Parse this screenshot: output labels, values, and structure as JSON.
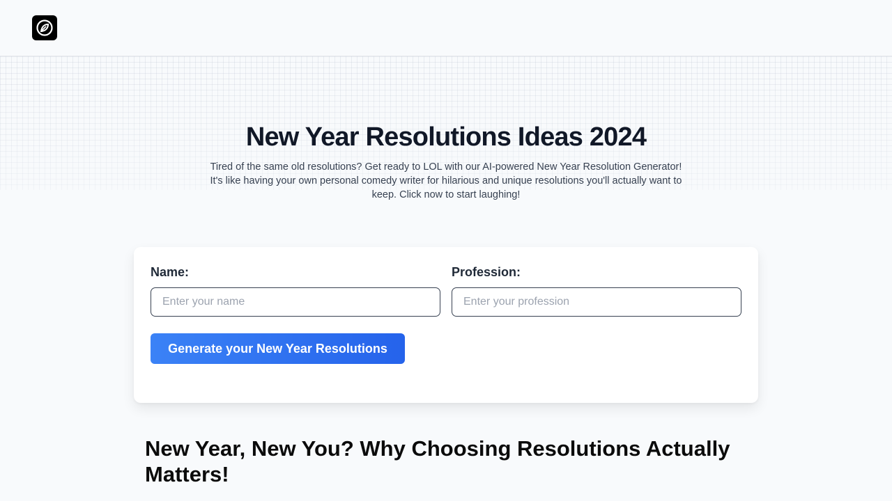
{
  "header": {
    "logo_icon": "leaf-circle-icon"
  },
  "hero": {
    "title": "New Year Resolutions Ideas 2024",
    "description": "Tired of the same old resolutions? Get ready to LOL with our AI-powered New Year Resolution Generator! It's like having your own personal comedy writer for hilarious and unique resolutions you'll actually want to keep. Click now to start laughing!"
  },
  "form": {
    "name_label": "Name:",
    "name_placeholder": "Enter your name",
    "name_value": "",
    "profession_label": "Profession:",
    "profession_placeholder": "Enter your profession",
    "profession_value": "",
    "submit_label": "Generate your New Year Resolutions"
  },
  "article": {
    "heading": "New Year, New You? Why Choosing Resolutions Actually Matters!"
  },
  "colors": {
    "accent": "#2563eb",
    "background": "#f8fafc",
    "text": "#111827"
  }
}
